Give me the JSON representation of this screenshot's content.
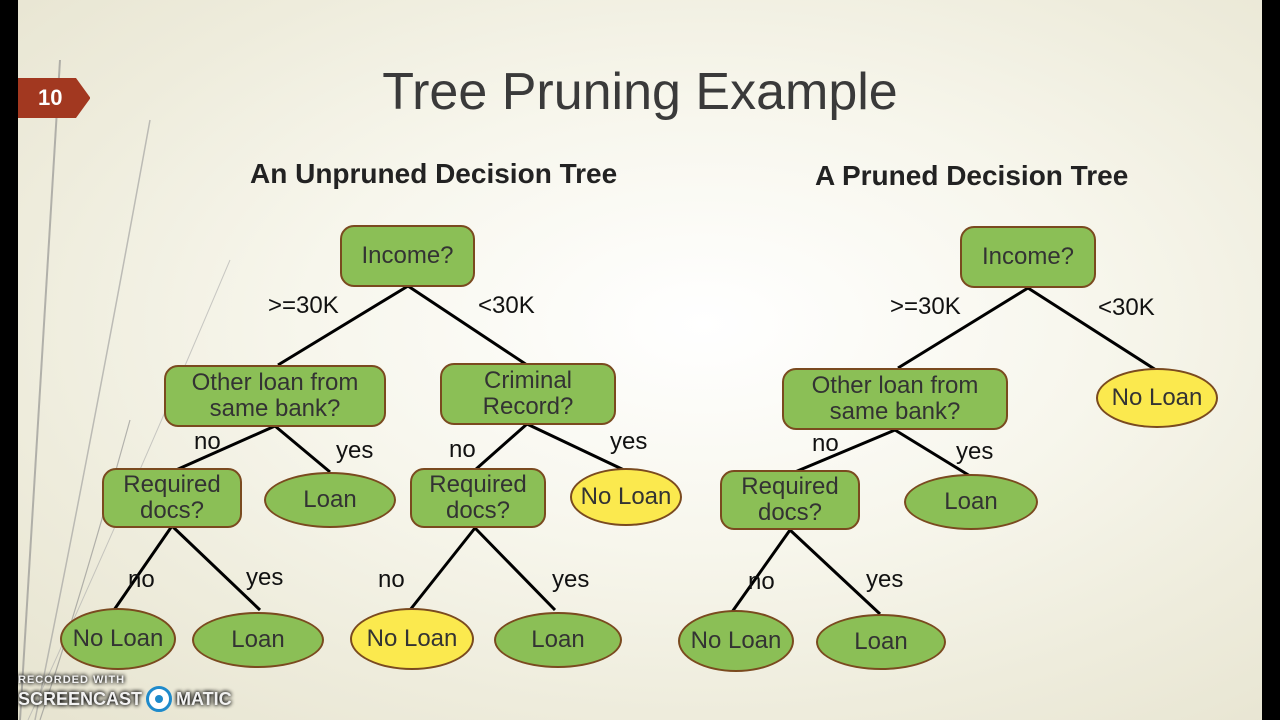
{
  "slide_number": "10",
  "title": "Tree Pruning Example",
  "left_subtitle": "An Unpruned Decision Tree",
  "right_subtitle": "A Pruned Decision Tree",
  "labels": {
    "income": "Income?",
    "ge30k": ">=30K",
    "lt30k": "<30K",
    "other_loan": "Other loan from same bank?",
    "criminal": "Criminal Record?",
    "required_docs": "Required docs?",
    "yes": "yes",
    "no": "no",
    "loan": "Loan",
    "no_loan": "No Loan"
  },
  "watermark": {
    "line1": "RECORDED WITH",
    "brand1": "SCREENCAST",
    "brand2": "MATIC"
  }
}
